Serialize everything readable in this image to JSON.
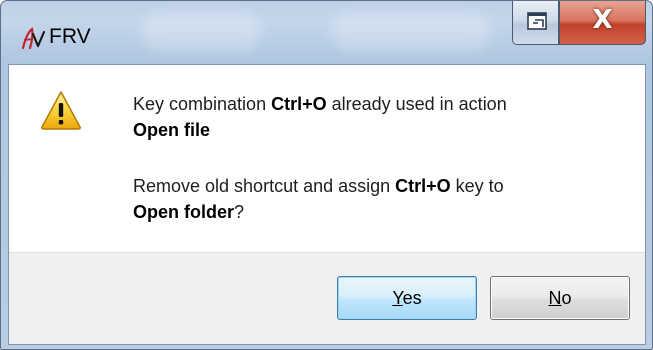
{
  "window": {
    "title": "FRV",
    "app_icon": "frv-logo-icon",
    "controls": {
      "restore_icon": "restore-icon",
      "close_label": "X"
    }
  },
  "dialog": {
    "icon": "warning-icon",
    "message1": {
      "before": "Key combination ",
      "shortcut": "Ctrl+O",
      "middle": " already used in action",
      "action": "Open file"
    },
    "message2": {
      "before": "Remove old shortcut and assign ",
      "shortcut": "Ctrl+O",
      "middle": " key to",
      "action": "Open folder",
      "after": "?"
    }
  },
  "buttons": {
    "yes": {
      "mnemonic": "Y",
      "rest": "es"
    },
    "no": {
      "mnemonic": "N",
      "rest": "o"
    }
  },
  "colors": {
    "frame": "#b9cde3",
    "close_button": "#c2412a",
    "default_button": "#bee6fd",
    "warning_yellow": "#f6c81f"
  }
}
